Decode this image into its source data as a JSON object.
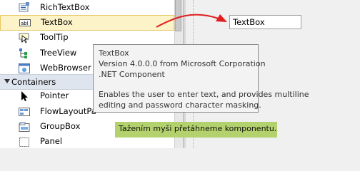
{
  "toolbox": {
    "items_top": [
      {
        "label": "RichTextBox",
        "icon": "richtextbox-icon"
      },
      {
        "label": "TextBox",
        "icon": "textbox-icon",
        "selected": true
      },
      {
        "label": "ToolTip",
        "icon": "tooltip-icon"
      },
      {
        "label": "TreeView",
        "icon": "treeview-icon"
      },
      {
        "label": "WebBrowser",
        "icon": "webbrowser-icon"
      }
    ],
    "category": "Containers",
    "items_bottom": [
      {
        "label": "Pointer",
        "icon": "pointer-icon"
      },
      {
        "label": "FlowLayoutPa",
        "icon": "flowlayoutpanel-icon"
      },
      {
        "label": "GroupBox",
        "icon": "groupbox-icon"
      },
      {
        "label": "Panel",
        "icon": "panel-icon"
      }
    ],
    "textbox_icon_text": "abl"
  },
  "designer": {
    "textbox_text": "TextBox"
  },
  "tooltip": {
    "title": "TextBox",
    "version": "Version 4.0.0.0 from Microsoft Corporation",
    "type": ".NET Component",
    "desc1": "Enables the user to enter text, and provides multiline",
    "desc2": "editing and password character masking."
  },
  "caption": "Tažením myši přetáhneme komponentu.",
  "colors": {
    "selected_bg": "#fdf3c8",
    "caption_bg": "#b3d26d",
    "arrow": "#e02020"
  }
}
